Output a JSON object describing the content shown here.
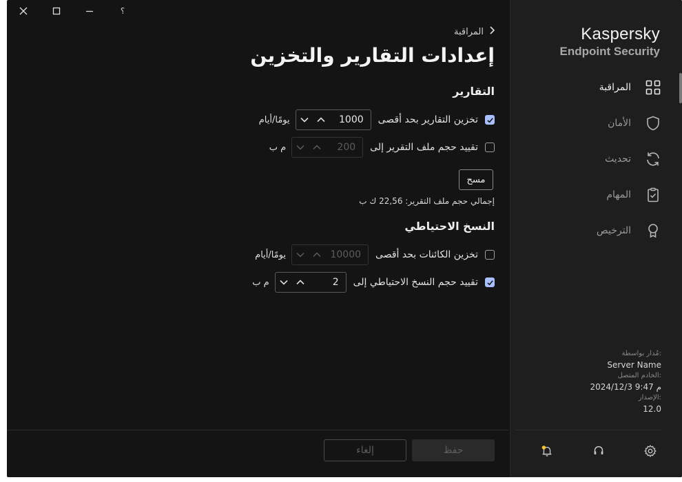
{
  "window": {
    "controls": {
      "close": "✕",
      "maximize": "☐",
      "minimize": "—",
      "help": "؟"
    }
  },
  "sidebar": {
    "brand_line1": "Kaspersky",
    "brand_line2": "Endpoint Security",
    "items": [
      {
        "label": "المراقبة",
        "icon": "grid-icon",
        "active": true
      },
      {
        "label": "الأمان",
        "icon": "shield-icon",
        "active": false
      },
      {
        "label": "تحديث",
        "icon": "refresh-icon",
        "active": false
      },
      {
        "label": "المهام",
        "icon": "clipboard-icon",
        "active": false
      },
      {
        "label": "الترخيص",
        "icon": "award-icon",
        "active": false
      }
    ],
    "meta": {
      "managed_by_label": "مُدار بواسطة:",
      "managed_by_value": "Server Name",
      "server_label": "الخادم المتصل:",
      "server_value": "2024/12/3 9:47 م",
      "version_label": "الإصدار:",
      "version_value": "12.0"
    },
    "bottom_icons": [
      "settings-icon",
      "support-icon",
      "notifications-icon"
    ]
  },
  "main": {
    "breadcrumb": "المراقبة",
    "title": "إعدادات التقارير والتخزين",
    "reports": {
      "heading": "التقارير",
      "store_label": "تخزين التقارير بحد أقصى",
      "store_checked": true,
      "store_value": "1000",
      "store_unit": "يومًا/أيام",
      "limit_label": "تقييد حجم ملف التقرير إلى",
      "limit_checked": false,
      "limit_value": "200",
      "limit_unit": "م ب",
      "clear_button": "مسح",
      "total_size": "إجمالي حجم ملف التقرير: 22,56 ك ب"
    },
    "backup": {
      "heading": "النسخ الاحتياطي",
      "store_label": "تخزين الكائنات بحد أقصى",
      "store_checked": false,
      "store_value": "10000",
      "store_unit": "يومًا/أيام",
      "limit_label": "تقييد حجم النسخ الاحتياطي إلى",
      "limit_checked": true,
      "limit_value": "2",
      "limit_unit": "م ب"
    },
    "footer": {
      "save": "حفظ",
      "cancel": "إلغاء"
    }
  },
  "colors": {
    "background": "#141414",
    "sidebar": "#1e1e1e",
    "checkbox_accent": "#a9c0ff",
    "notification_dot": "#f2c230"
  }
}
